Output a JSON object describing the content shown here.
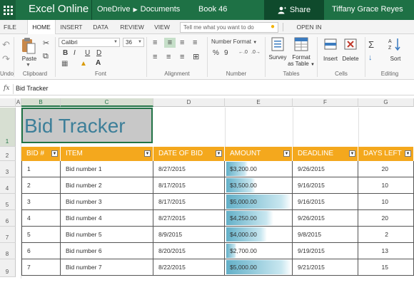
{
  "titlebar": {
    "app_title": "Excel Online",
    "breadcrumb_root": "OneDrive",
    "breadcrumb_folder": "Documents",
    "book_name": "Book 46",
    "share_label": "Share",
    "user_name": "Tiffany Grace Reyes"
  },
  "tabs": [
    {
      "label": "FILE"
    },
    {
      "label": "HOME",
      "active": true
    },
    {
      "label": "INSERT"
    },
    {
      "label": "DATA"
    },
    {
      "label": "REVIEW"
    },
    {
      "label": "VIEW"
    }
  ],
  "tell_me": "Tell me what you want to do",
  "open_in_excel": "OPEN IN EXCEL",
  "ribbon": {
    "undo_label": "Undo",
    "clipboard": {
      "paste_label": "Paste",
      "group_label": "Clipboard"
    },
    "font": {
      "name": "Calibri",
      "size": "36",
      "group_label": "Font",
      "bold": "B",
      "italic": "I",
      "underline": "U",
      "doubleunderline": "D"
    },
    "alignment": {
      "group_label": "Alignment"
    },
    "number": {
      "format": "Number Format",
      "group_label": "Number",
      "percent": "%",
      "comma": "9"
    },
    "tables": {
      "survey_label": "Survey",
      "format_label_1": "Format",
      "format_label_2": "as Table",
      "group_label": "Tables"
    },
    "cells": {
      "insert_label": "Insert",
      "delete_label": "Delete",
      "group_label": "Cells"
    },
    "editing": {
      "sort_label": "Sort",
      "group_label": "Editing"
    }
  },
  "formula_bar": {
    "fx": "fx",
    "value": "Bid Tracker"
  },
  "columns": [
    "A",
    "B",
    "C",
    "D",
    "E",
    "F",
    "G"
  ],
  "rows": [
    "1",
    "2",
    "3",
    "4",
    "5",
    "6",
    "7",
    "8",
    "9"
  ],
  "sheet": {
    "title": "Bid Tracker",
    "headers": [
      "BID #",
      "ITEM",
      "DATE OF BID",
      "AMOUNT",
      "DEADLINE",
      "DAYS LEFT"
    ],
    "records": [
      {
        "bid": "1",
        "item": "Bid number 1",
        "date": "8/27/2015",
        "amount": "$3,200.00",
        "amount_value": 3200,
        "deadline": "9/26/2015",
        "days_left": "20"
      },
      {
        "bid": "2",
        "item": "Bid number 2",
        "date": "8/17/2015",
        "amount": "$3,500.00",
        "amount_value": 3500,
        "deadline": "9/16/2015",
        "days_left": "10"
      },
      {
        "bid": "3",
        "item": "Bid number 3",
        "date": "8/17/2015",
        "amount": "$5,000.00",
        "amount_value": 5000,
        "deadline": "9/16/2015",
        "days_left": "10"
      },
      {
        "bid": "4",
        "item": "Bid number 4",
        "date": "8/27/2015",
        "amount": "$4,250.00",
        "amount_value": 4250,
        "deadline": "9/26/2015",
        "days_left": "20"
      },
      {
        "bid": "5",
        "item": "Bid number 5",
        "date": "8/9/2015",
        "amount": "$4,000.00",
        "amount_value": 4000,
        "deadline": "9/8/2015",
        "days_left": "2"
      },
      {
        "bid": "6",
        "item": "Bid number 6",
        "date": "8/20/2015",
        "amount": "$2,700.00",
        "amount_value": 2700,
        "deadline": "9/19/2015",
        "days_left": "13"
      },
      {
        "bid": "7",
        "item": "Bid number 7",
        "date": "8/22/2015",
        "amount": "$5,000.00",
        "amount_value": 5000,
        "deadline": "9/21/2015",
        "days_left": "15"
      }
    ]
  },
  "colors": {
    "brand": "#1e7145",
    "header_fill": "#f4a81d",
    "title_text": "#3d7f99",
    "databar": "#63b0c8"
  }
}
